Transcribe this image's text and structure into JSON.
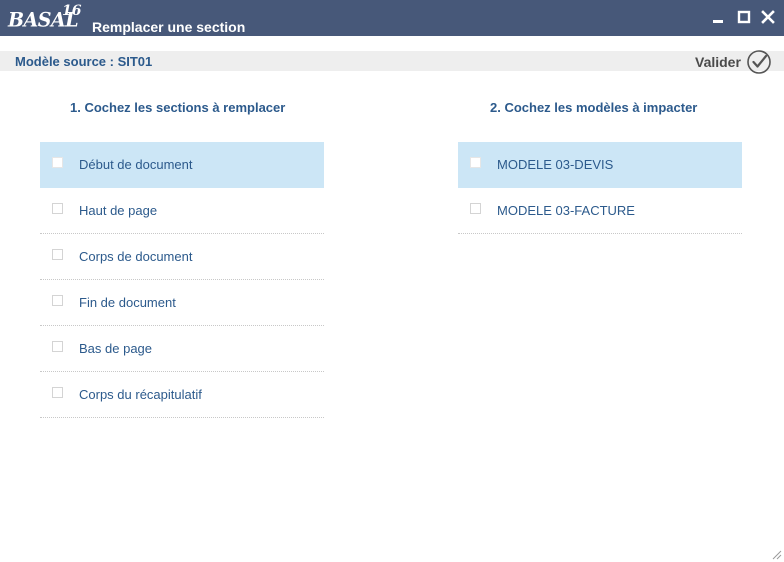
{
  "app": {
    "logo_text": "BASAL",
    "logo_version": "16",
    "window_title": "Remplacer une section"
  },
  "source": {
    "label": "Modèle source : SIT01"
  },
  "actions": {
    "validate_label": "Valider"
  },
  "sections": {
    "title": "1. Cochez les sections à remplacer",
    "items": [
      {
        "label": "Début de document",
        "checked": false,
        "highlighted": true
      },
      {
        "label": "Haut de page",
        "checked": false,
        "highlighted": false
      },
      {
        "label": "Corps de document",
        "checked": false,
        "highlighted": false
      },
      {
        "label": "Fin de document",
        "checked": false,
        "highlighted": false
      },
      {
        "label": "Bas de page",
        "checked": false,
        "highlighted": false
      },
      {
        "label": "Corps du récapitulatif",
        "checked": false,
        "highlighted": false
      }
    ]
  },
  "models": {
    "title": "2. Cochez les modèles à impacter",
    "items": [
      {
        "label": "MODELE 03-DEVIS",
        "checked": false,
        "highlighted": true
      },
      {
        "label": "MODELE 03-FACTURE",
        "checked": false,
        "highlighted": false
      }
    ]
  },
  "colors": {
    "titlebar": "#475879",
    "accent_text": "#2c5a8c",
    "highlight_row": "#cce6f6",
    "source_bar": "#eeeeee"
  },
  "icons": {
    "minimize": "minimize-icon",
    "maximize": "maximize-icon",
    "close": "close-icon",
    "validate": "checkmark-circle-icon",
    "resize": "resize-grip-icon"
  }
}
